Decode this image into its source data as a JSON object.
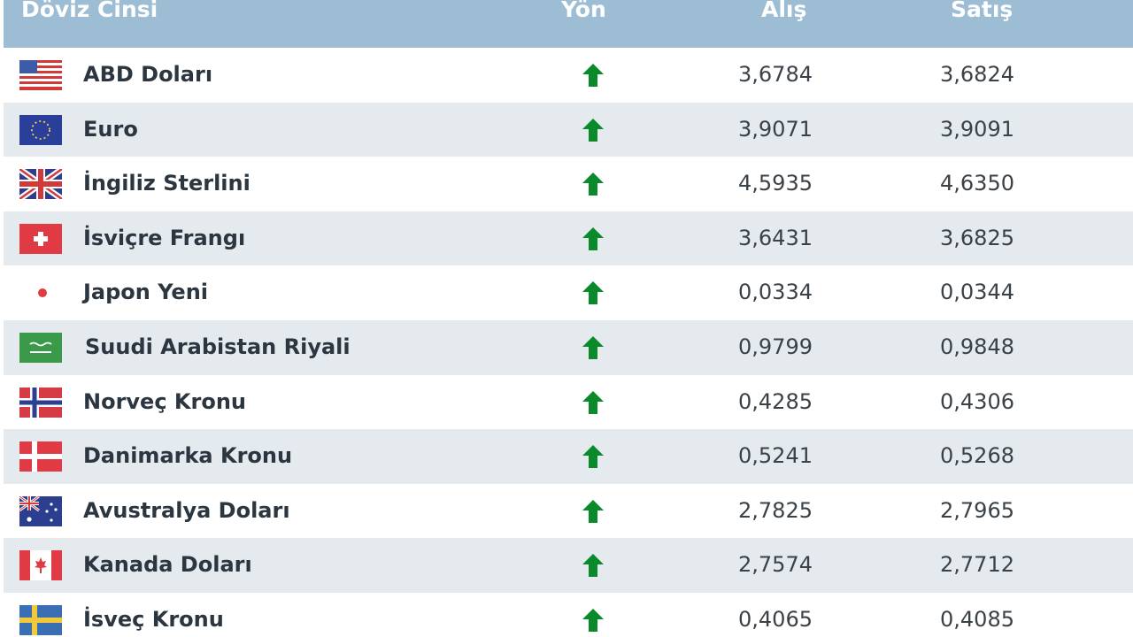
{
  "header": {
    "name": "Döviz Cinsi",
    "direction": "Yön",
    "buy": "Alış",
    "sell": "Satış"
  },
  "colors": {
    "header_bg": "#9cbdd3",
    "row_alt_bg": "#e4eaee",
    "arrow_up": "#0a8a2a"
  },
  "rows": [
    {
      "name": "ABD Doları",
      "flag": "us-flag-icon",
      "direction": "up",
      "buy": "3,6784",
      "sell": "3,6824"
    },
    {
      "name": "Euro",
      "flag": "eu-flag-icon",
      "direction": "up",
      "buy": "3,9071",
      "sell": "3,9091"
    },
    {
      "name": "İngiliz Sterlini",
      "flag": "uk-flag-icon",
      "direction": "up",
      "buy": "4,5935",
      "sell": "4,6350"
    },
    {
      "name": "İsviçre Frangı",
      "flag": "ch-flag-icon",
      "direction": "up",
      "buy": "3,6431",
      "sell": "3,6825"
    },
    {
      "name": "Japon Yeni",
      "flag": "jp-flag-icon",
      "direction": "up",
      "buy": "0,0334",
      "sell": "0,0344"
    },
    {
      "name": "Suudi Arabistan Riyali",
      "flag": "sa-flag-icon",
      "direction": "up",
      "buy": "0,9799",
      "sell": "0,9848"
    },
    {
      "name": "Norveç Kronu",
      "flag": "no-flag-icon",
      "direction": "up",
      "buy": "0,4285",
      "sell": "0,4306"
    },
    {
      "name": "Danimarka Kronu",
      "flag": "dk-flag-icon",
      "direction": "up",
      "buy": "0,5241",
      "sell": "0,5268"
    },
    {
      "name": "Avustralya Doları",
      "flag": "au-flag-icon",
      "direction": "up",
      "buy": "2,7825",
      "sell": "2,7965"
    },
    {
      "name": "Kanada Doları",
      "flag": "ca-flag-icon",
      "direction": "up",
      "buy": "2,7574",
      "sell": "2,7712"
    },
    {
      "name": "İsveç Kronu",
      "flag": "se-flag-icon",
      "direction": "up",
      "buy": "0,4065",
      "sell": "0,4085"
    }
  ]
}
